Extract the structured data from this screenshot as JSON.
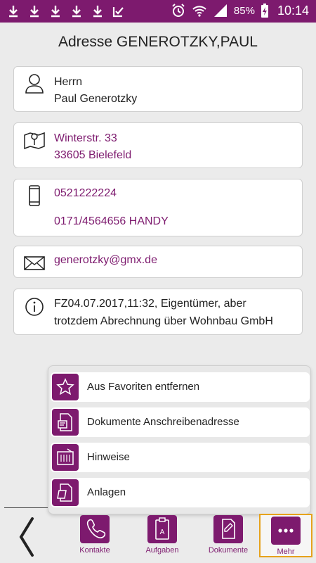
{
  "status_bar": {
    "battery": "85%",
    "time": "10:14"
  },
  "header": {
    "title": "Adresse GENEROTZKY,PAUL"
  },
  "cards": {
    "name": {
      "salutation": "Herrn",
      "full_name": "Paul Generotzky"
    },
    "address": {
      "street": "Winterstr. 33",
      "city": "33605 Bielefeld"
    },
    "phone": {
      "landline": "0521222224",
      "mobile": "0171/4564656 HANDY"
    },
    "email": {
      "address": "generotzky@gmx.de"
    },
    "info": {
      "line1": "FZ04.07.2017,11:32, Eigentümer, aber",
      "line2": "trotzdem Abrechnung über Wohnbau GmbH"
    }
  },
  "popup_menu": {
    "items": [
      {
        "label": "Aus Favoriten entfernen",
        "icon": "star-icon"
      },
      {
        "label": "Dokumente Anschreibenadresse",
        "icon": "document-icon"
      },
      {
        "label": "Hinweise",
        "icon": "notes-icon"
      },
      {
        "label": "Anlagen",
        "icon": "attachment-icon"
      }
    ]
  },
  "tabs": {
    "contacts": "Kontakte",
    "tasks": "Aufgaben",
    "documents": "Dokumente",
    "more": "Mehr"
  },
  "colors": {
    "accent": "#7d1a6e",
    "active_tab_border": "#e6a21c"
  }
}
